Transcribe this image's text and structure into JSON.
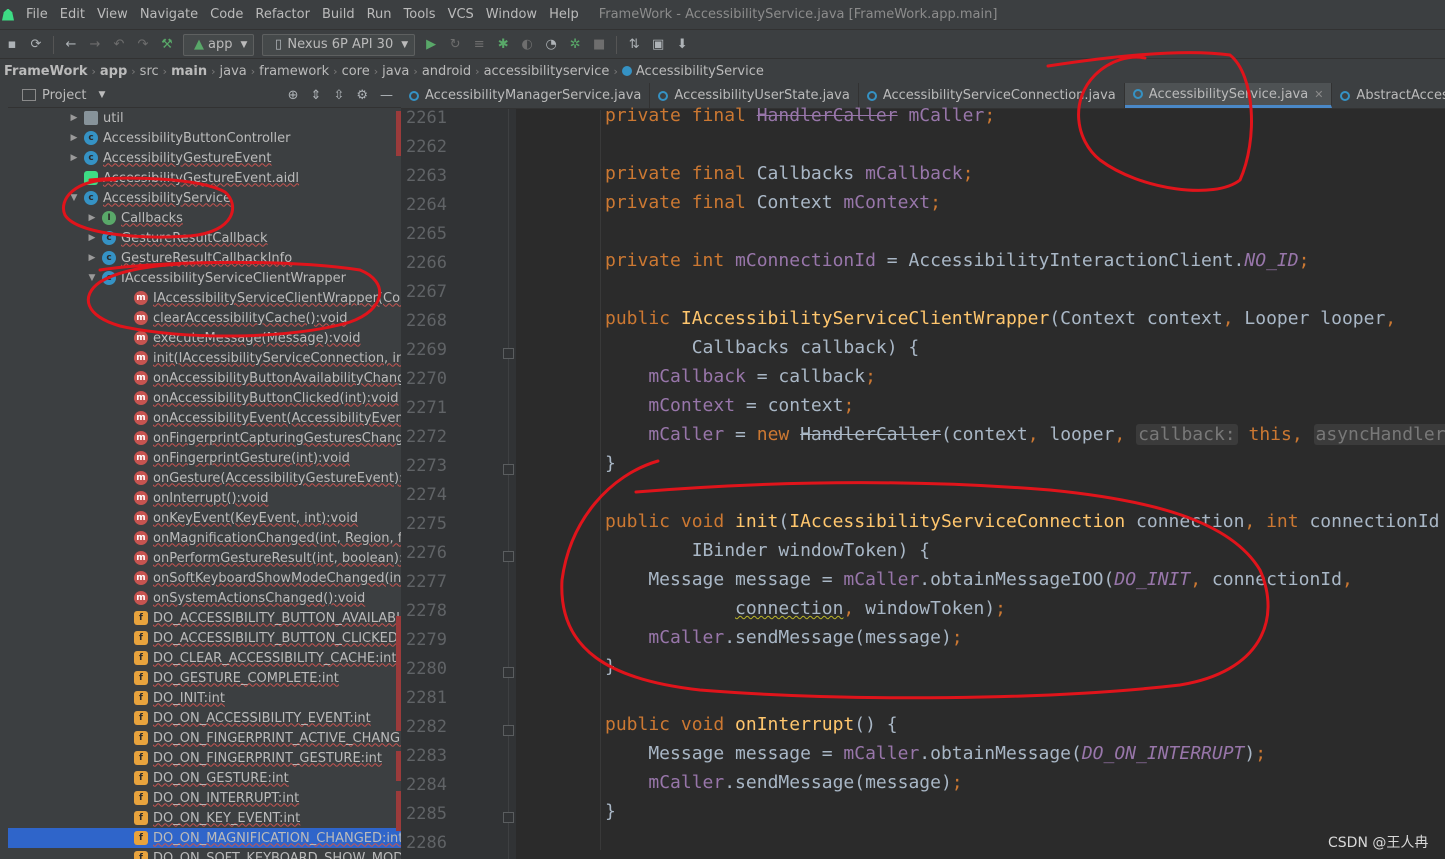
{
  "menu": {
    "items": [
      "File",
      "Edit",
      "View",
      "Navigate",
      "Code",
      "Refactor",
      "Build",
      "Run",
      "Tools",
      "VCS",
      "Window",
      "Help"
    ],
    "window_title": "FrameWork - AccessibilityService.java [FrameWork.app.main]"
  },
  "toolbar": {
    "config_combo": "app",
    "device_combo": "Nexus 6P API 30"
  },
  "breadcrumb": [
    "FrameWork",
    "app",
    "src",
    "main",
    "java",
    "framework",
    "core",
    "java",
    "android",
    "accessibilityservice",
    "AccessibilityService"
  ],
  "project_panel": {
    "title": "Project",
    "tree": [
      {
        "label": "util",
        "icon": "folder",
        "arrow": "▶",
        "indent": 0
      },
      {
        "label": "AccessibilityButtonController",
        "icon": "class",
        "arrow": "▶",
        "indent": 0
      },
      {
        "label": "AccessibilityGestureEvent",
        "icon": "class",
        "arrow": "▶",
        "indent": 0
      },
      {
        "label": "AccessibilityGestureEvent.aidl",
        "icon": "aidl",
        "arrow": "",
        "indent": 0
      },
      {
        "label": "AccessibilityService",
        "icon": "class",
        "arrow": "▼",
        "indent": 0
      },
      {
        "label": "Callbacks",
        "icon": "interface",
        "arrow": "▶",
        "indent": 1
      },
      {
        "label": "GestureResultCallback",
        "icon": "class",
        "arrow": "▶",
        "indent": 1
      },
      {
        "label": "GestureResultCallbackInfo",
        "icon": "class",
        "arrow": "▶",
        "indent": 1
      },
      {
        "label": "IAccessibilityServiceClientWrapper",
        "icon": "class",
        "arrow": "▼",
        "indent": 1
      },
      {
        "label": "IAccessibilityServiceClientWrapper(Context, Lo",
        "icon": "method",
        "arrow": "",
        "indent": 2
      },
      {
        "label": "clearAccessibilityCache():void",
        "icon": "method",
        "arrow": "",
        "indent": 2
      },
      {
        "label": "executeMessage(Message):void",
        "icon": "method",
        "arrow": "",
        "indent": 2
      },
      {
        "label": "init(IAccessibilityServiceConnection, int, IBinde",
        "icon": "method",
        "arrow": "",
        "indent": 2
      },
      {
        "label": "onAccessibilityButtonAvailabilityChanged(boo",
        "icon": "method",
        "arrow": "",
        "indent": 2
      },
      {
        "label": "onAccessibilityButtonClicked(int):void",
        "icon": "method",
        "arrow": "",
        "indent": 2
      },
      {
        "label": "onAccessibilityEvent(AccessibilityEvent, boolea",
        "icon": "method",
        "arrow": "",
        "indent": 2
      },
      {
        "label": "onFingerprintCapturingGesturesChanged(boo",
        "icon": "method",
        "arrow": "",
        "indent": 2
      },
      {
        "label": "onFingerprintGesture(int):void",
        "icon": "method",
        "arrow": "",
        "indent": 2
      },
      {
        "label": "onGesture(AccessibilityGestureEvent):void",
        "icon": "method",
        "arrow": "",
        "indent": 2
      },
      {
        "label": "onInterrupt():void",
        "icon": "method",
        "arrow": "",
        "indent": 2
      },
      {
        "label": "onKeyEvent(KeyEvent, int):void",
        "icon": "method",
        "arrow": "",
        "indent": 2
      },
      {
        "label": "onMagnificationChanged(int, Region, float, flo",
        "icon": "method",
        "arrow": "",
        "indent": 2
      },
      {
        "label": "onPerformGestureResult(int, boolean):void",
        "icon": "method",
        "arrow": "",
        "indent": 2
      },
      {
        "label": "onSoftKeyboardShowModeChanged(int):void",
        "icon": "method",
        "arrow": "",
        "indent": 2
      },
      {
        "label": "onSystemActionsChanged():void",
        "icon": "method",
        "arrow": "",
        "indent": 2
      },
      {
        "label": "DO_ACCESSIBILITY_BUTTON_AVAILABILITY_CH",
        "icon": "field",
        "arrow": "",
        "indent": 2
      },
      {
        "label": "DO_ACCESSIBILITY_BUTTON_CLICKED:int",
        "icon": "field",
        "arrow": "",
        "indent": 2
      },
      {
        "label": "DO_CLEAR_ACCESSIBILITY_CACHE:int",
        "icon": "field",
        "arrow": "",
        "indent": 2
      },
      {
        "label": "DO_GESTURE_COMPLETE:int",
        "icon": "field",
        "arrow": "",
        "indent": 2
      },
      {
        "label": "DO_INIT:int",
        "icon": "field",
        "arrow": "",
        "indent": 2
      },
      {
        "label": "DO_ON_ACCESSIBILITY_EVENT:int",
        "icon": "field",
        "arrow": "",
        "indent": 2
      },
      {
        "label": "DO_ON_FINGERPRINT_ACTIVE_CHANGED:int",
        "icon": "field",
        "arrow": "",
        "indent": 2
      },
      {
        "label": "DO_ON_FINGERPRINT_GESTURE:int",
        "icon": "field",
        "arrow": "",
        "indent": 2
      },
      {
        "label": "DO_ON_GESTURE:int",
        "icon": "field",
        "arrow": "",
        "indent": 2
      },
      {
        "label": "DO_ON_INTERRUPT:int",
        "icon": "field",
        "arrow": "",
        "indent": 2
      },
      {
        "label": "DO_ON_KEY_EVENT:int",
        "icon": "field",
        "arrow": "",
        "indent": 2
      },
      {
        "label": "DO_ON_MAGNIFICATION_CHANGED:int",
        "icon": "field",
        "arrow": "",
        "indent": 2,
        "selected": true
      },
      {
        "label": "DO_ON_SOFT_KEYBOARD_SHOW_MODE_CH",
        "icon": "field",
        "arrow": "",
        "indent": 2
      }
    ]
  },
  "editor_tabs": [
    {
      "label": "AccessibilityManagerService.java",
      "active": false
    },
    {
      "label": "AccessibilityUserState.java",
      "active": false
    },
    {
      "label": "AccessibilityServiceConnection.java",
      "active": false
    },
    {
      "label": "AccessibilityService.java",
      "active": true
    },
    {
      "label": "AbstractAccessibilitySer",
      "active": false
    }
  ],
  "editor": {
    "line_numbers": [
      "2261",
      "2262",
      "2263",
      "2264",
      "2265",
      "2266",
      "2267",
      "2268",
      "2269",
      "2270",
      "2271",
      "2272",
      "2273",
      "2274",
      "2275",
      "2276",
      "2277",
      "2278",
      "2279",
      "2280",
      "2281",
      "2282",
      "2283",
      "2284",
      "2285",
      "2286"
    ],
    "code_lines": [
      [
        {
          "t": "kw",
          "v": "private final "
        },
        {
          "t": "dep",
          "v": "HandlerCaller"
        },
        {
          "t": "plain",
          "v": " "
        },
        {
          "t": "field",
          "v": "mCaller"
        },
        {
          "t": "kw",
          "v": ";"
        }
      ],
      [],
      [
        {
          "t": "kw",
          "v": "private final "
        },
        {
          "t": "plain",
          "v": "Callbacks "
        },
        {
          "t": "field",
          "v": "mCallback"
        },
        {
          "t": "kw",
          "v": ";"
        }
      ],
      [
        {
          "t": "kw",
          "v": "private final "
        },
        {
          "t": "plain",
          "v": "Context "
        },
        {
          "t": "field",
          "v": "mContext"
        },
        {
          "t": "kw",
          "v": ";"
        }
      ],
      [],
      [
        {
          "t": "kw",
          "v": "private int "
        },
        {
          "t": "field",
          "v": "mConnectionId"
        },
        {
          "t": "plain",
          "v": " = AccessibilityInteractionClient."
        },
        {
          "t": "static",
          "v": "NO_ID"
        },
        {
          "t": "kw",
          "v": ";"
        }
      ],
      [],
      [
        {
          "t": "kw",
          "v": "public "
        },
        {
          "t": "fn",
          "v": "IAccessibilityServiceClientWrapper"
        },
        {
          "t": "plain",
          "v": "(Context context"
        },
        {
          "t": "kw",
          "v": ", "
        },
        {
          "t": "plain",
          "v": "Looper looper"
        },
        {
          "t": "kw",
          "v": ","
        }
      ],
      [
        {
          "t": "plain",
          "v": "        Callbacks callback) {"
        }
      ],
      [
        {
          "t": "plain",
          "v": "    "
        },
        {
          "t": "field",
          "v": "mCallback"
        },
        {
          "t": "plain",
          "v": " = callback"
        },
        {
          "t": "kw",
          "v": ";"
        }
      ],
      [
        {
          "t": "plain",
          "v": "    "
        },
        {
          "t": "field",
          "v": "mContext"
        },
        {
          "t": "plain",
          "v": " = context"
        },
        {
          "t": "kw",
          "v": ";"
        }
      ],
      [
        {
          "t": "plain",
          "v": "    "
        },
        {
          "t": "field",
          "v": "mCaller"
        },
        {
          "t": "plain",
          "v": " = "
        },
        {
          "t": "kw",
          "v": "new "
        },
        {
          "t": "strike",
          "v": "HandlerCaller"
        },
        {
          "t": "plain",
          "v": "(context"
        },
        {
          "t": "kw",
          "v": ", "
        },
        {
          "t": "plain",
          "v": "looper"
        },
        {
          "t": "kw",
          "v": ", "
        },
        {
          "t": "hint",
          "v": "callback:"
        },
        {
          "t": "kw",
          "v": " this, "
        },
        {
          "t": "hint",
          "v": "asyncHandler:"
        }
      ],
      [
        {
          "t": "plain",
          "v": "}"
        }
      ],
      [],
      [
        {
          "t": "kw",
          "v": "public void "
        },
        {
          "t": "fn",
          "v": "init"
        },
        {
          "t": "plain",
          "v": "("
        },
        {
          "t": "iface",
          "v": "IAccessibilityServiceConnection"
        },
        {
          "t": "plain",
          "v": " connection"
        },
        {
          "t": "kw",
          "v": ", int "
        },
        {
          "t": "plain",
          "v": "connectionId"
        }
      ],
      [
        {
          "t": "plain",
          "v": "        IBinder windowToken) {"
        }
      ],
      [
        {
          "t": "plain",
          "v": "    Message message = "
        },
        {
          "t": "field",
          "v": "mCaller"
        },
        {
          "t": "plain",
          "v": ".obtainMessageIOO("
        },
        {
          "t": "static",
          "v": "DO_INIT"
        },
        {
          "t": "kw",
          "v": ", "
        },
        {
          "t": "plain",
          "v": "connectionId"
        },
        {
          "t": "kw",
          "v": ","
        }
      ],
      [
        {
          "t": "plain",
          "v": "            "
        },
        {
          "t": "warn",
          "v": "connection"
        },
        {
          "t": "kw",
          "v": ", "
        },
        {
          "t": "plain",
          "v": "windowToken)"
        },
        {
          "t": "kw",
          "v": ";"
        }
      ],
      [
        {
          "t": "plain",
          "v": "    "
        },
        {
          "t": "field",
          "v": "mCaller"
        },
        {
          "t": "plain",
          "v": ".sendMessage(message)"
        },
        {
          "t": "kw",
          "v": ";"
        }
      ],
      [
        {
          "t": "plain",
          "v": "}"
        }
      ],
      [],
      [
        {
          "t": "kw",
          "v": "public void "
        },
        {
          "t": "fn",
          "v": "onInterrupt"
        },
        {
          "t": "plain",
          "v": "() {"
        }
      ],
      [
        {
          "t": "plain",
          "v": "    Message message = "
        },
        {
          "t": "field",
          "v": "mCaller"
        },
        {
          "t": "plain",
          "v": ".obtainMessage("
        },
        {
          "t": "static",
          "v": "DO_ON_INTERRUPT"
        },
        {
          "t": "plain",
          "v": ")"
        },
        {
          "t": "kw",
          "v": ";"
        }
      ],
      [
        {
          "t": "plain",
          "v": "    "
        },
        {
          "t": "field",
          "v": "mCaller"
        },
        {
          "t": "plain",
          "v": ".sendMessage(message)"
        },
        {
          "t": "kw",
          "v": ";"
        }
      ],
      [
        {
          "t": "plain",
          "v": "}"
        }
      ],
      []
    ]
  },
  "watermark": "CSDN @王人冉",
  "colors": {
    "background": "#2b2b2b",
    "panel": "#3c3f41",
    "keyword": "#cc7832",
    "field": "#9876aa",
    "function": "#ffc66d",
    "annotation_red": "#e0141b",
    "selection": "#2f65ca"
  }
}
